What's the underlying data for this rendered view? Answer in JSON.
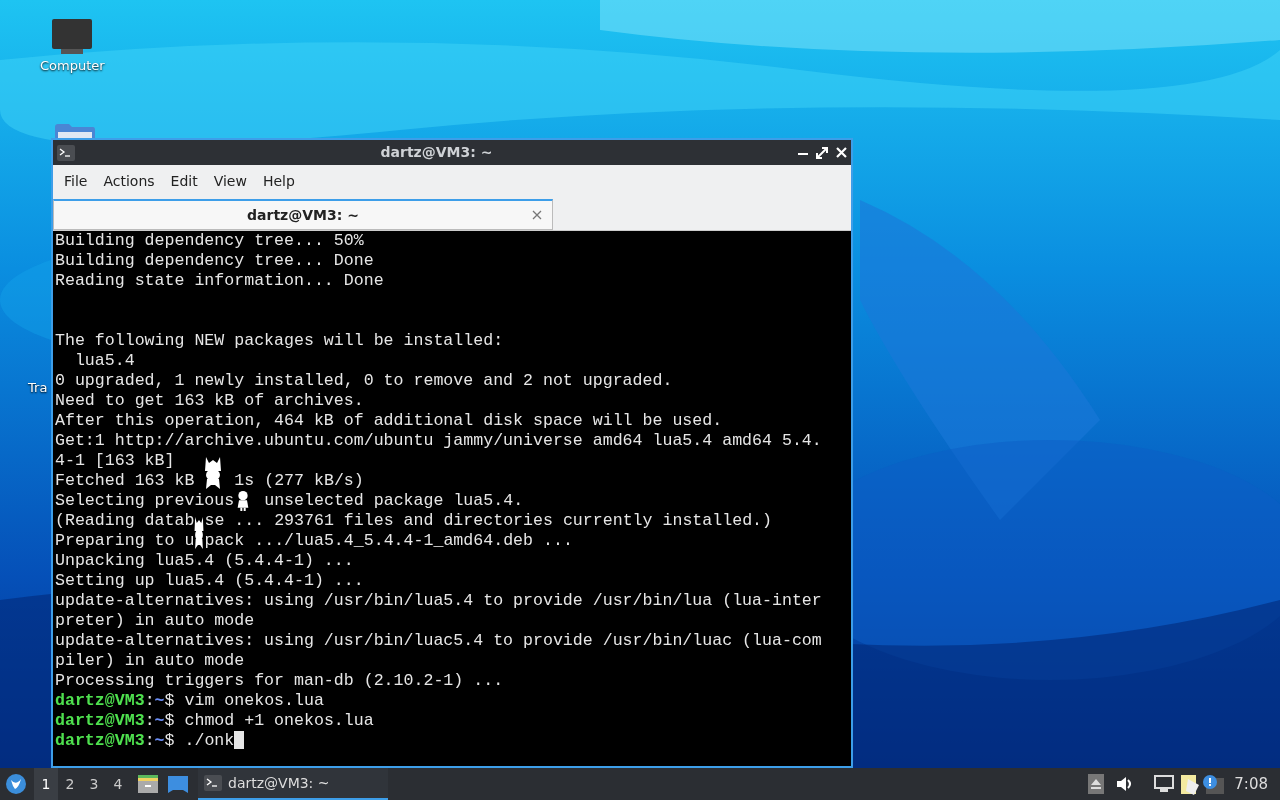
{
  "desktop_icons": [
    {
      "label": "Computer",
      "kind": "computer"
    },
    {
      "label": "Tra",
      "kind": "trash"
    }
  ],
  "window": {
    "title": "dartz@VM3: ~",
    "active": true
  },
  "menu": [
    "File",
    "Actions",
    "Edit",
    "View",
    "Help"
  ],
  "tabs": [
    {
      "label": "dartz@VM3: ~",
      "selected": true
    }
  ],
  "terminal": {
    "lines": [
      {
        "kind": "output",
        "text": "Building dependency tree... 50%"
      },
      {
        "kind": "output",
        "text": "Building dependency tree... Done"
      },
      {
        "kind": "output",
        "text": "Reading state information... Done"
      },
      {
        "kind": "blank"
      },
      {
        "kind": "blank"
      },
      {
        "kind": "output",
        "text": "The following NEW packages will be installed:"
      },
      {
        "kind": "output",
        "text": "  lua5.4"
      },
      {
        "kind": "output",
        "text": "0 upgraded, 1 newly installed, 0 to remove and 2 not upgraded."
      },
      {
        "kind": "output",
        "text": "Need to get 163 kB of archives."
      },
      {
        "kind": "output",
        "text": "After this operation, 464 kB of additional disk space will be used."
      },
      {
        "kind": "output",
        "text": "Get:1 http://archive.ubuntu.com/ubuntu jammy/universe amd64 lua5.4 amd64 5.4."
      },
      {
        "kind": "output",
        "text": "4-1 [163 kB]"
      },
      {
        "kind": "partly_covered",
        "parts": [
          {
            "kind": "text",
            "text": "Fetched 163 kB "
          },
          {
            "kind": "cat"
          },
          {
            "kind": "text",
            "text": " 1s (277 kB/s)"
          }
        ]
      },
      {
        "kind": "partly_covered",
        "parts": [
          {
            "kind": "text",
            "text": "Selecting previous"
          },
          {
            "kind": "girl"
          },
          {
            "kind": "text",
            "text": " unselected package lua5.4."
          }
        ]
      },
      {
        "kind": "partly_covered",
        "parts": [
          {
            "kind": "text",
            "text": "(Reading datab"
          },
          {
            "kind": "gap"
          },
          {
            "kind": "text",
            "text": "se ... 293761 files and directories currently installed.)"
          }
        ]
      },
      {
        "kind": "partly_covered",
        "parts": [
          {
            "kind": "text",
            "text": "Preparing to u"
          },
          {
            "kind": "kitten"
          },
          {
            "kind": "text",
            "text": "pack .../lua5.4_5.4.4-1_amd64.deb ..."
          }
        ]
      },
      {
        "kind": "output",
        "text": "Unpacking lua5.4 (5.4.4-1) ..."
      },
      {
        "kind": "output",
        "text": "Setting up lua5.4 (5.4.4-1) ..."
      },
      {
        "kind": "output",
        "text": "update-alternatives: using /usr/bin/lua5.4 to provide /usr/bin/lua (lua-inter"
      },
      {
        "kind": "output",
        "text": "preter) in auto mode"
      },
      {
        "kind": "output",
        "text": "update-alternatives: using /usr/bin/luac5.4 to provide /usr/bin/luac (lua-com"
      },
      {
        "kind": "output",
        "text": "piler) in auto mode"
      },
      {
        "kind": "output",
        "text": "Processing triggers for man-db (2.10.2-1) ..."
      },
      {
        "kind": "prompt",
        "user_host": "dartz@VM3",
        "separator": ":",
        "path": "~",
        "command": "$ vim onekos.lua",
        "cursor": false
      },
      {
        "kind": "prompt",
        "user_host": "dartz@VM3",
        "separator": ":",
        "path": "~",
        "command": "$ chmod +1 onekos.lua",
        "cursor": false
      },
      {
        "kind": "prompt",
        "user_host": "dartz@VM3",
        "separator": ":",
        "path": "~",
        "command": "$ ./onk",
        "cursor": true
      }
    ]
  },
  "taskbar": {
    "workspaces": [
      {
        "label": "1",
        "selected": true
      },
      {
        "label": "2",
        "selected": false
      },
      {
        "label": "3",
        "selected": false
      },
      {
        "label": "4",
        "selected": false
      }
    ],
    "tasks": [
      {
        "label": "dartz@VM3: ~",
        "selected": true
      }
    ],
    "clock": "7:08"
  }
}
